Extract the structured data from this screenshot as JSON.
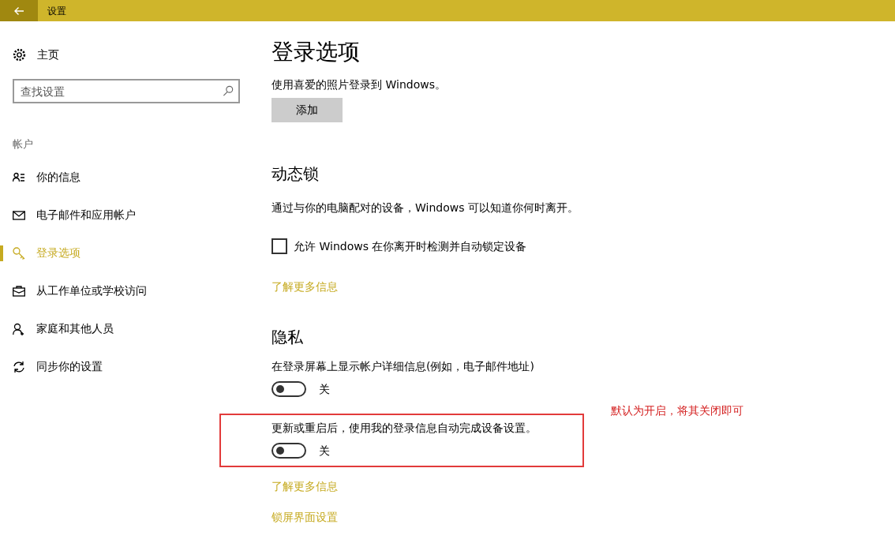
{
  "window": {
    "title": "设置"
  },
  "sidebar": {
    "home": "主页",
    "search": {
      "placeholder": "查找设置"
    },
    "section": "帐户",
    "items": [
      {
        "label": "你的信息",
        "selected": false
      },
      {
        "label": "电子邮件和应用帐户",
        "selected": false
      },
      {
        "label": "登录选项",
        "selected": true
      },
      {
        "label": "从工作单位或学校访问",
        "selected": false
      },
      {
        "label": "家庭和其他人员",
        "selected": false
      },
      {
        "label": "同步你的设置",
        "selected": false
      }
    ]
  },
  "page": {
    "title": "登录选项",
    "picture_text": "使用喜爱的照片登录到 Windows。",
    "add_button": "添加",
    "dynamic_lock": {
      "heading": "动态锁",
      "description": "通过与你的电脑配对的设备，Windows 可以知道你何时离开。",
      "checkbox": {
        "label": "允许 Windows 在你离开时检测并自动锁定设备",
        "checked": false
      },
      "link": "了解更多信息"
    },
    "privacy": {
      "heading": "隐私",
      "settings": [
        {
          "label": "在登录屏幕上显示帐户详细信息(例如，电子邮件地址)",
          "on": false,
          "state_text": "关",
          "highlighted": false
        },
        {
          "label": "更新或重启后，使用我的登录信息自动完成设备设置。",
          "on": false,
          "state_text": "关",
          "highlighted": true
        }
      ],
      "links": [
        "了解更多信息",
        "锁屏界面设置"
      ]
    }
  },
  "annotation": "默认为开启，将其关闭即可"
}
